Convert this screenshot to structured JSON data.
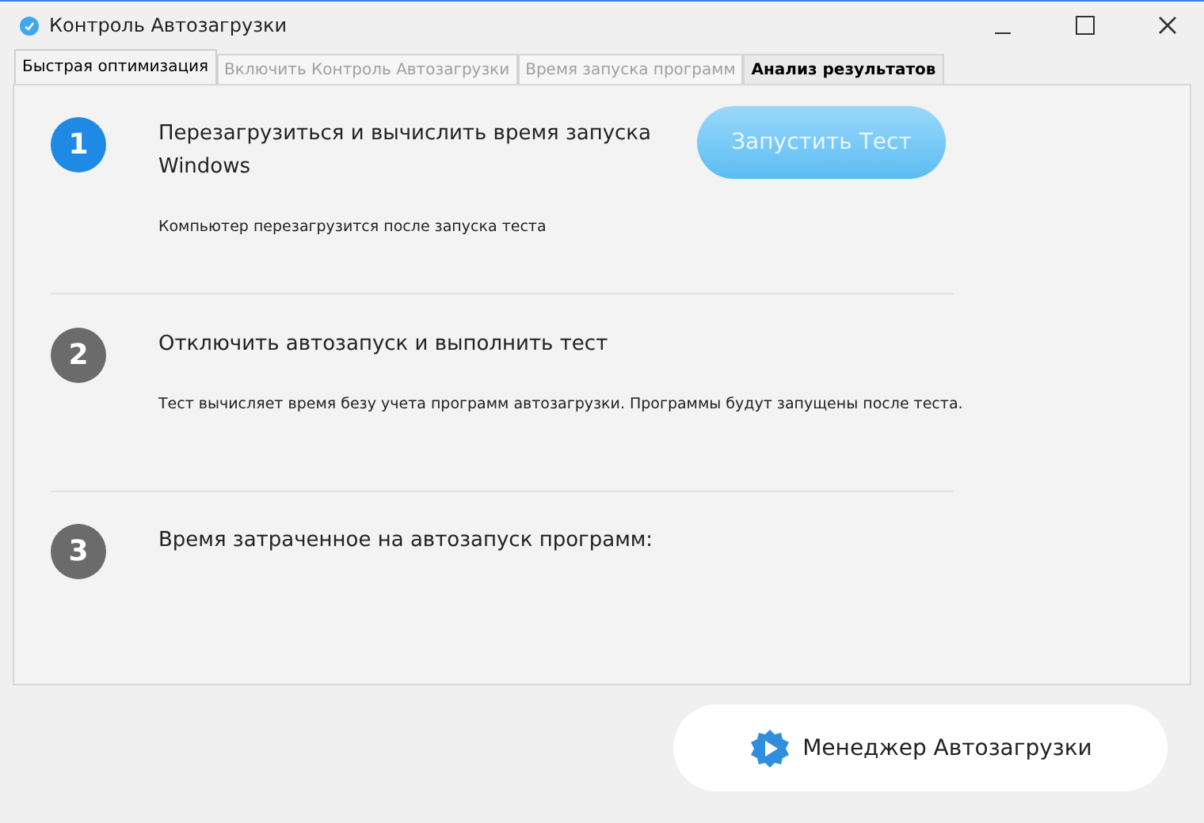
{
  "window": {
    "title": "Контроль Автозагрузки"
  },
  "tabs": [
    {
      "label": "Быстрая оптимизация",
      "selected": true,
      "disabled": false
    },
    {
      "label": "Включить Контроль Автозагрузки",
      "selected": false,
      "disabled": true
    },
    {
      "label": "Время запуска программ",
      "selected": false,
      "disabled": true
    },
    {
      "label": "Анализ результатов",
      "selected": false,
      "disabled": false
    }
  ],
  "steps": [
    {
      "number": "1",
      "active": true,
      "title": "Перезагрузиться и вычислить время запуска Windows",
      "button": "Запустить Тест",
      "description": "Компьютер перезагрузится после запуска теста"
    },
    {
      "number": "2",
      "active": false,
      "title": "Отключить автозапуск и выполнить тест",
      "description": "Тест вычисляет время безу учета программ автозагрузки. Программы будут запущены после теста."
    },
    {
      "number": "3",
      "active": false,
      "title": "Время затраченное на автозапуск программ:"
    }
  ],
  "footer_button": "Менеджер Автозагрузки"
}
